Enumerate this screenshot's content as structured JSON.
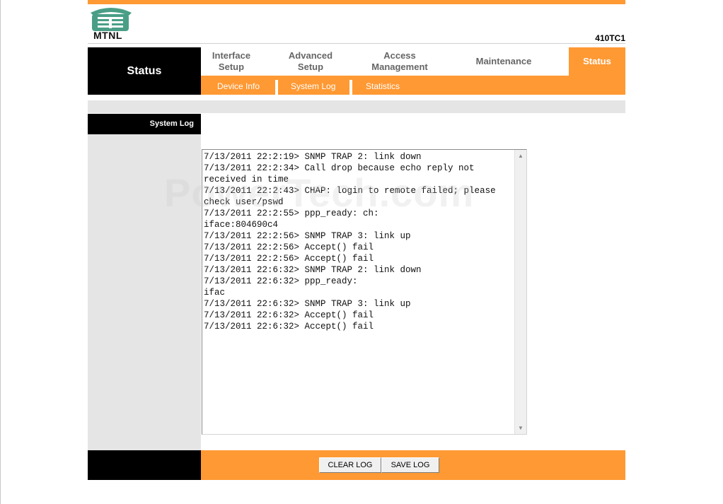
{
  "header": {
    "brand": "MTNL",
    "model": "410TC1"
  },
  "nav": {
    "section_title": "Status",
    "tabs": [
      {
        "line1": "Interface",
        "line2": "Setup"
      },
      {
        "line1": "Advanced",
        "line2": "Setup"
      },
      {
        "line1": "Access",
        "line2": "Management"
      },
      {
        "line1": "Maintenance",
        "line2": ""
      },
      {
        "line1": "Status",
        "line2": ""
      }
    ],
    "subtabs": [
      "Device Info",
      "System Log",
      "Statistics"
    ]
  },
  "sidebar": {
    "label": "System Log"
  },
  "log": {
    "text": "7/13/2011 22:2:19> SNMP TRAP 2: link down\n7/13/2011 22:2:34> Call drop because echo reply not received in time\n7/13/2011 22:2:43> CHAP: login to remote failed; please check user/pswd\n7/13/2011 22:2:55> ppp_ready: ch:\niface:804690c4\n7/13/2011 22:2:56> SNMP TRAP 3: link up\n7/13/2011 22:2:56> Accept() fail\n7/13/2011 22:2:56> Accept() fail\n7/13/2011 22:6:32> SNMP TRAP 2: link down\n7/13/2011 22:6:32> ppp_ready:\nifac\n7/13/2011 22:6:32> SNMP TRAP 3: link up\n7/13/2011 22:6:32> Accept() fail\n7/13/2011 22:6:32> Accept() fail"
  },
  "watermark": "PowerTech.com",
  "buttons": {
    "clear": "CLEAR LOG",
    "save": "SAVE LOG"
  }
}
